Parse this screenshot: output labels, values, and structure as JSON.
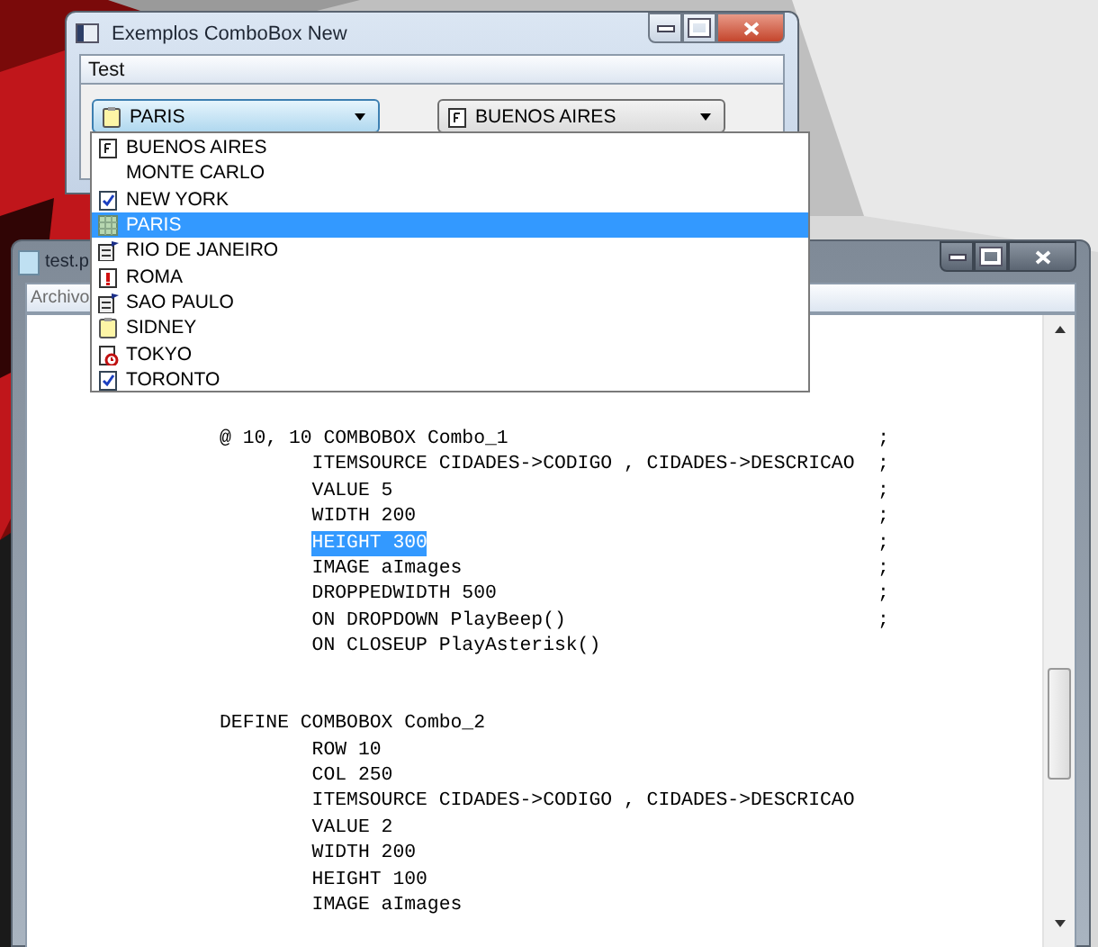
{
  "windows": [
    {
      "title": "Exemplos ComboBox New",
      "active": true,
      "menu": [
        "Test"
      ],
      "combos": [
        {
          "value": "PARIS",
          "kind": "note",
          "focused": true
        },
        {
          "value": "BUENOS AIRES",
          "kind": "f-card",
          "focused": false
        }
      ]
    },
    {
      "title": "test.p",
      "active": false,
      "menu": [
        "Archivo"
      ],
      "code": [
        {
          "head": "@ 10, 10 COMBOBOX Combo_1",
          "end": ";",
          "lines": [
            {
              "text": "ITEMSOURCE CIDADES->CODIGO , CIDADES->DESCRICAO",
              "end": ";",
              "selected": false
            },
            {
              "text": "VALUE 5",
              "end": ";",
              "selected": false
            },
            {
              "text": "WIDTH 200",
              "end": ";",
              "selected": false
            },
            {
              "text": "HEIGHT 300",
              "end": ";",
              "selected": true
            },
            {
              "text": "IMAGE aImages",
              "end": ";",
              "selected": false
            },
            {
              "text": "DROPPEDWIDTH 500",
              "end": ";",
              "selected": false
            },
            {
              "text": "ON DROPDOWN PlayBeep()",
              "end": ";",
              "selected": false
            },
            {
              "text": "ON CLOSEUP PlayAsterisk()",
              "selected": false
            }
          ]
        },
        {
          "head": "DEFINE COMBOBOX Combo_2",
          "lines": [
            {
              "text": "ROW 10",
              "selected": false
            },
            {
              "text": "COL 250",
              "selected": false
            },
            {
              "text": "ITEMSOURCE CIDADES->CODIGO , CIDADES->DESCRICAO",
              "selected": false
            },
            {
              "text": "VALUE 2",
              "selected": false
            },
            {
              "text": "WIDTH 200",
              "selected": false
            },
            {
              "text": "HEIGHT 100",
              "selected": false
            },
            {
              "text": "IMAGE aImages",
              "selected": false
            }
          ]
        }
      ]
    }
  ],
  "dropdown": {
    "items": [
      {
        "label": "BUENOS AIRES",
        "kind": "f-card",
        "selected": false
      },
      {
        "label": "MONTE CARLO",
        "kind": "none",
        "selected": false
      },
      {
        "label": "NEW YORK",
        "kind": "check",
        "selected": false
      },
      {
        "label": "PARIS",
        "kind": "grid",
        "selected": true
      },
      {
        "label": "RIO DE JANEIRO",
        "kind": "cabinet",
        "selected": false
      },
      {
        "label": "ROMA",
        "kind": "alert",
        "selected": false
      },
      {
        "label": "SAO PAULO",
        "kind": "cabinet",
        "selected": false
      },
      {
        "label": "SIDNEY",
        "kind": "note",
        "selected": false
      },
      {
        "label": "TOKYO",
        "kind": "clock",
        "selected": false
      },
      {
        "label": "TORONTO",
        "kind": "check",
        "selected": false
      }
    ]
  }
}
